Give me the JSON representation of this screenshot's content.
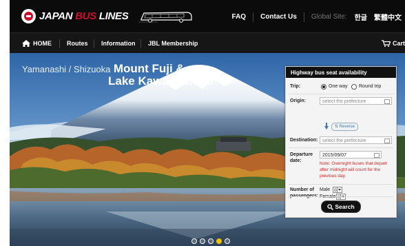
{
  "brand": {
    "name_part1": "JAPAN ",
    "name_part2": "BUS",
    "name_part3": " LINES"
  },
  "top_links": {
    "faq": "FAQ",
    "contact": "Contact Us",
    "global_label": "Global Site:",
    "lang_korean": "한글",
    "lang_chinese": "繁體中文"
  },
  "nav": {
    "home": "HOME",
    "routes": "Routes",
    "information": "Information",
    "membership": "JBL Membership",
    "cart": "Cart"
  },
  "hero": {
    "subtitle": "Yamanashi / Shizuoka",
    "title_line1": "Mount Fuji &",
    "title_line2": "Lake Kawaguchiko"
  },
  "widget": {
    "title": "Highway bus seat availability",
    "trip_label": "Trip:",
    "one_way": "One way",
    "round_trip": "Round trip",
    "origin_label": "Origin:",
    "origin_placeholder": "select the prefecture",
    "reverse_label": "Reverse",
    "destination_label": "Destination:",
    "destination_placeholder": "select the prefecture",
    "departure_label_1": "Departure",
    "departure_label_2": "date:",
    "departure_value": "2015/09/07",
    "note": "Note: Overnight buses that depart after midnight will count for the previous day.",
    "passengers_label_1": "Number of",
    "passengers_label_2": "passengers:",
    "male_label": "Male",
    "male_value": "0",
    "female_label": "Female",
    "female_value": "0",
    "search_label": "Search"
  },
  "slider": {
    "count": 5,
    "active_index": 3
  },
  "colors": {
    "brand_red": "#c8102e",
    "note_red": "#dd2222",
    "active_dot": "#f2c200"
  }
}
